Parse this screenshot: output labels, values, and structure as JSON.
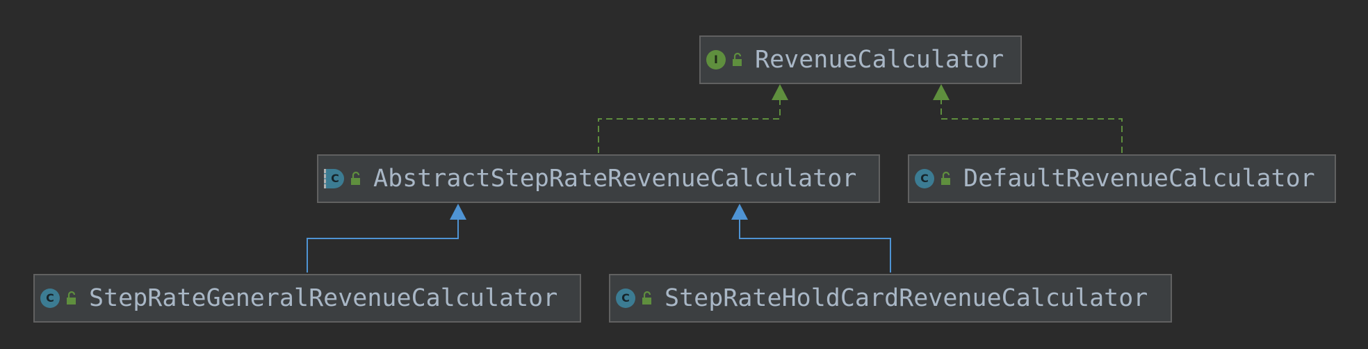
{
  "diagram": {
    "nodes": [
      {
        "id": "revenue-calculator",
        "label": "RevenueCalculator",
        "kind": "interface",
        "kind_letter": "I"
      },
      {
        "id": "abstract-step-rate-revenue-calculator",
        "label": "AbstractStepRateRevenueCalculator",
        "kind": "abstract",
        "kind_letter": "C"
      },
      {
        "id": "default-revenue-calculator",
        "label": "DefaultRevenueCalculator",
        "kind": "class",
        "kind_letter": "C"
      },
      {
        "id": "step-rate-general-revenue-calculator",
        "label": "StepRateGeneralRevenueCalculator",
        "kind": "class",
        "kind_letter": "C"
      },
      {
        "id": "step-rate-hold-card-revenue-calculator",
        "label": "StepRateHoldCardRevenueCalculator",
        "kind": "class",
        "kind_letter": "C"
      }
    ],
    "edges": [
      {
        "from": "abstract-step-rate-revenue-calculator",
        "to": "revenue-calculator",
        "type": "implements"
      },
      {
        "from": "default-revenue-calculator",
        "to": "revenue-calculator",
        "type": "implements"
      },
      {
        "from": "step-rate-general-revenue-calculator",
        "to": "abstract-step-rate-revenue-calculator",
        "type": "extends"
      },
      {
        "from": "step-rate-hold-card-revenue-calculator",
        "to": "abstract-step-rate-revenue-calculator",
        "type": "extends"
      }
    ],
    "colors": {
      "background": "#2b2b2b",
      "node_fill": "#3c3f41",
      "node_border": "#616161",
      "text": "#a9b7c6",
      "implements_edge": "#5f8f3e",
      "extends_edge": "#4f94d4",
      "interface_badge": "#5f8f3e",
      "class_badge": "#3c7c93",
      "lock": "#5f8f3e"
    },
    "icons": {
      "interface": "interface-icon",
      "class": "class-icon",
      "abstract": "abstract-class-icon",
      "visibility": "public-lock-icon"
    }
  }
}
